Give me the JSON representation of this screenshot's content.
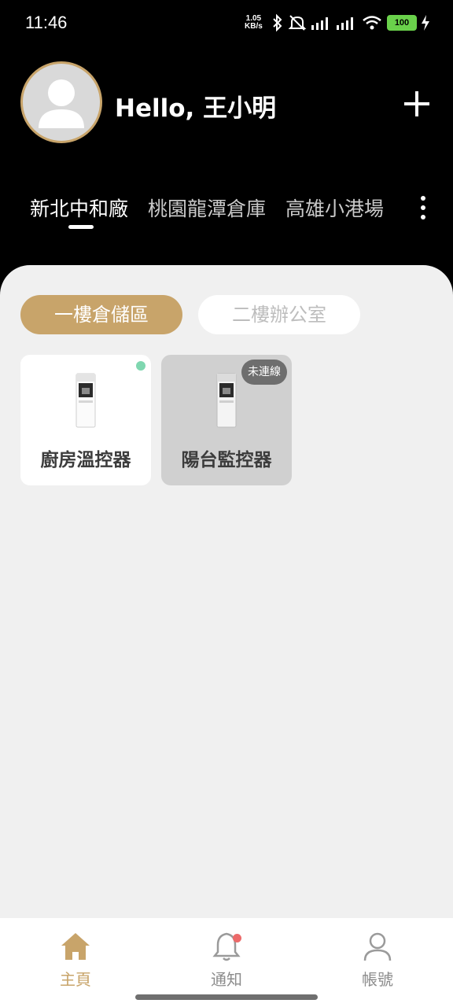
{
  "status_bar": {
    "time": "11:46",
    "net_speed_value": "1.05",
    "net_speed_unit": "KB/s",
    "battery": "100"
  },
  "header": {
    "greeting": "Hello, 王小明",
    "add_icon": "plus-icon"
  },
  "sites": {
    "tabs": [
      {
        "label": "新北中和廠",
        "active": true
      },
      {
        "label": "桃園龍潭倉庫",
        "active": false
      },
      {
        "label": "高雄小港場",
        "active": false
      }
    ],
    "more_icon": "more-vertical-icon"
  },
  "areas": {
    "tabs": [
      {
        "label": "一樓倉儲區",
        "active": true
      },
      {
        "label": "二樓辦公室",
        "active": false
      }
    ]
  },
  "devices": [
    {
      "name": "廚房溫控器",
      "online": true
    },
    {
      "name": "陽台監控器",
      "online": false,
      "status": "未連線"
    }
  ],
  "bottom_nav": {
    "items": [
      {
        "label": "主頁",
        "icon": "home-icon",
        "active": true
      },
      {
        "label": "通知",
        "icon": "bell-icon",
        "active": false
      },
      {
        "label": "帳號",
        "icon": "user-icon",
        "active": false
      }
    ]
  },
  "colors": {
    "accent": "#c8a46a",
    "online": "#7fd7b0",
    "notification": "#ec6a6a",
    "header_bg": "#000000",
    "panel_bg": "#f0f0f0"
  }
}
